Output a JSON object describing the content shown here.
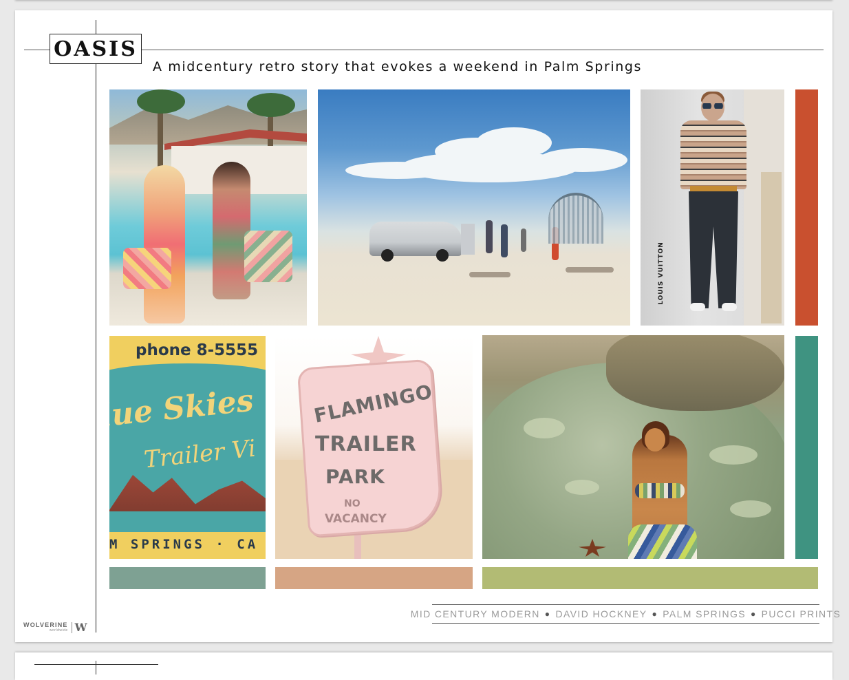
{
  "slide": {
    "title": "OASIS",
    "subtitle": "A midcentury retro story that evokes a weekend in Palm Springs"
  },
  "images": {
    "pool": {
      "icon": "pool-party-photo"
    },
    "desert": {
      "icon": "desert-car-photo"
    },
    "runway": {
      "icon": "runway-photo",
      "credit": "LOUIS VUITTON"
    },
    "matchbook": {
      "icon": "blue-skies-matchbook",
      "phone": "phone 8-5555",
      "script_line1": "lue Skies",
      "script_line2": "Trailer Vi",
      "bottom_text": "M SPRINGS · CA"
    },
    "sign": {
      "icon": "flamingo-trailer-park-sign",
      "line1": "FLAMINGO",
      "line2": "TRAILER",
      "line3": "PARK",
      "line4": "NO",
      "line5": "VACANCY"
    },
    "rock": {
      "icon": "pucci-bikini-photo"
    }
  },
  "swatches": {
    "vertical": [
      "#c9502f",
      "#3f9381"
    ],
    "horizontal": [
      "#7ea193",
      "#d6a584",
      "#b2bb74"
    ]
  },
  "tags": [
    "MID CENTURY MODERN",
    "DAVID HOCKNEY",
    "PALM SPRINGS",
    "PUCCI PRINTS"
  ],
  "logo": {
    "brand": "WOLVERINE",
    "sub": "worldwide",
    "mark": "W"
  }
}
